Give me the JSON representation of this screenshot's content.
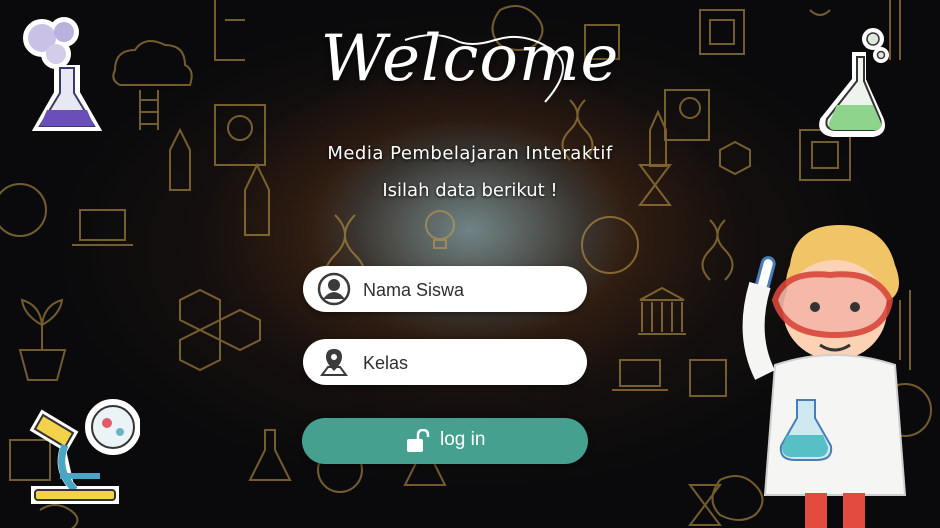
{
  "welcome_title": "Welcome",
  "subtitle": "Media Pembelajaran Interaktif",
  "instruction": "Isilah data berikut !",
  "form": {
    "name_placeholder": "Nama Siswa",
    "class_placeholder": "Kelas",
    "login_label": "log in"
  },
  "colors": {
    "button": "#45a08f",
    "field_bg": "#ffffff",
    "icon_gold": "#c9a14a"
  },
  "icons": [
    "user-icon",
    "location-pin-icon",
    "unlock-icon"
  ],
  "decor": [
    "test-tube-cartoon",
    "green-flask-sticker",
    "purple-flask-sticker",
    "microscope-sticker",
    "scientist-kid-cartoon",
    "science-icon-pattern"
  ]
}
